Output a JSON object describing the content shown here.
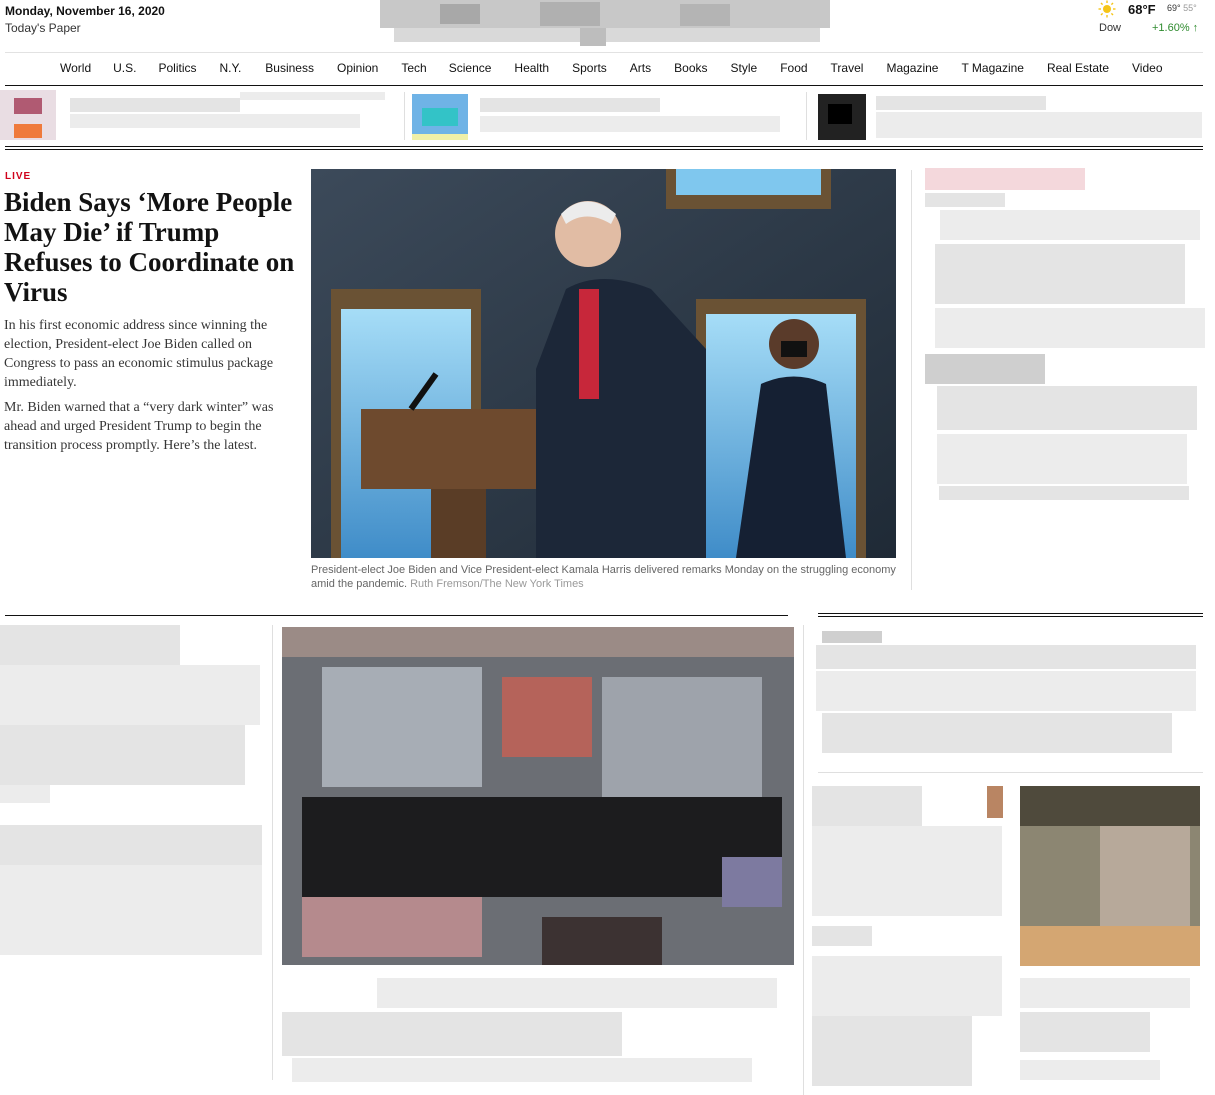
{
  "masthead": {
    "date": "Monday, November 16, 2020",
    "todays_paper": "Today's Paper"
  },
  "weather": {
    "icon": "sun-icon",
    "temp": "68°F",
    "high": "69°",
    "low": "55°"
  },
  "markets": {
    "label": "Dow",
    "change": "+1.60% ↑",
    "color_up": "#2e8b2e"
  },
  "nav": {
    "items": [
      "World",
      "U.S.",
      "Politics",
      "N.Y.",
      "Business",
      "Opinion",
      "Tech",
      "Science",
      "Health",
      "Sports",
      "Arts",
      "Books",
      "Style",
      "Food",
      "Travel",
      "Magazine",
      "T Magazine",
      "Real Estate",
      "Video"
    ]
  },
  "lead": {
    "kicker": "LIVE",
    "kicker_color": "#d0021b",
    "headline": "Biden Says ‘More People May Die’ if Trump Refuses to Coordinate on Virus",
    "summary_1": "In his first economic address since winning the election, President-elect Joe Biden called on Congress to pass an economic stimulus package immediately.",
    "summary_2": "Mr. Biden warned that a “very dark winter” was ahead and urged President Trump to begin the transition process promptly. Here’s the latest.",
    "caption": "President-elect Joe Biden and Vice President-elect Kamala Harris delivered remarks Monday on the struggling economy amid the pandemic.",
    "credit": "Ruth Fremson/The New York Times"
  }
}
